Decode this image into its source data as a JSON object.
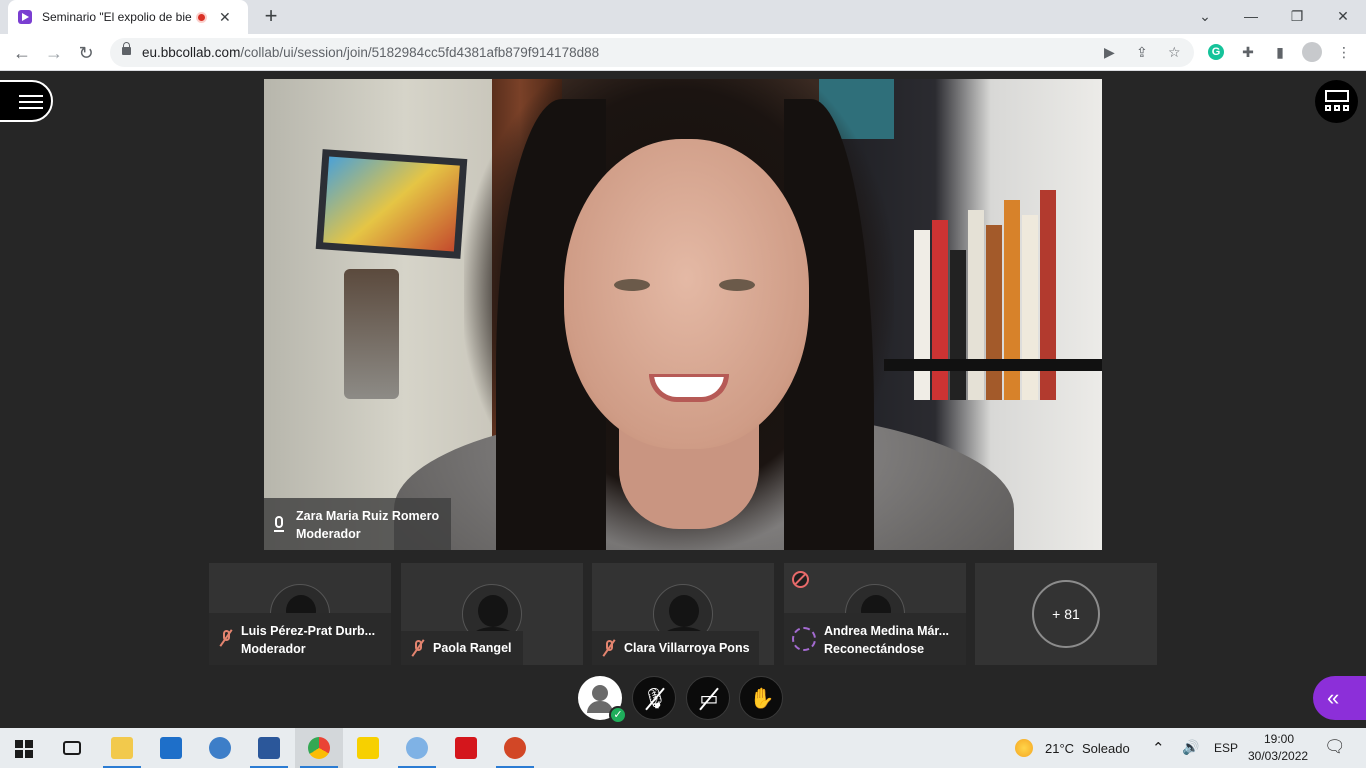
{
  "browser": {
    "tab_title": "Seminario \"El expolio de bie",
    "tab_close": "✕",
    "new_tab": "+",
    "url_host": "eu.bbcollab.com",
    "url_path": "/collab/ui/session/join/5182984cc5fd4381afb879f914178d88",
    "window_controls": [
      "⌄",
      "—",
      "❐",
      "✕"
    ]
  },
  "session": {
    "main_speaker": {
      "name": "Zara Maria Ruiz Romero",
      "role": "Moderador"
    },
    "participants": [
      {
        "name": "Luis Pérez-Prat Durb...",
        "role": "Moderador",
        "status": "muted"
      },
      {
        "name": "Paola Rangel",
        "role": "",
        "status": "muted"
      },
      {
        "name": "Clara Villarroya Pons",
        "role": "",
        "status": "muted"
      },
      {
        "name": "Andrea Medina Már...",
        "role": "Reconectándose",
        "status": "reconnecting"
      }
    ],
    "more_participants": "+ 81"
  },
  "colors": {
    "accent_purple": "#8c2fd9",
    "mute_red": "#e3846f",
    "status_green": "#1fae5b"
  },
  "taskbar": {
    "weather_temp": "21°C",
    "weather_text": "Soleado",
    "lang": "ESP",
    "time": "19:00",
    "date": "30/03/2022"
  }
}
